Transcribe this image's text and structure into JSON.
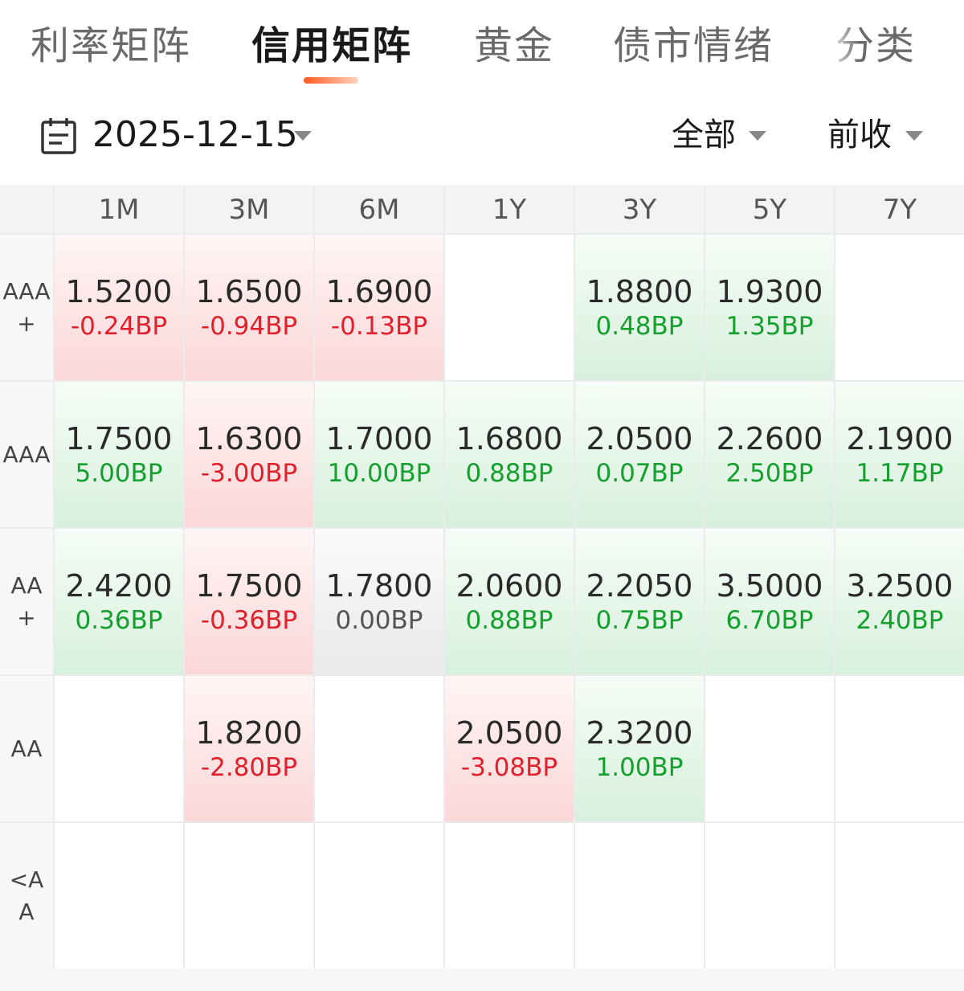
{
  "tabs": [
    "利率矩阵",
    "信用矩阵",
    "黄金",
    "债市情绪",
    "分类"
  ],
  "active_tab": 1,
  "filters": {
    "date": "2025-12-15",
    "scope": "全部",
    "price_basis": "前收"
  },
  "colors": {
    "accent": "#ff5a1f",
    "up_text": "#e0202a",
    "down_text": "#14a02c",
    "up_bg": "#fbd7d8",
    "down_bg": "#d7f0dd"
  },
  "matrix": {
    "columns": [
      "1M",
      "3M",
      "6M",
      "1Y",
      "3Y",
      "5Y",
      "7Y"
    ],
    "rows": [
      {
        "label": "AAA+",
        "cells": [
          {
            "value": "1.5200",
            "change": "-0.24BP",
            "trend": "up"
          },
          {
            "value": "1.6500",
            "change": "-0.94BP",
            "trend": "up"
          },
          {
            "value": "1.6900",
            "change": "-0.13BP",
            "trend": "up"
          },
          null,
          {
            "value": "1.8800",
            "change": "0.48BP",
            "trend": "down"
          },
          {
            "value": "1.9300",
            "change": "1.35BP",
            "trend": "down"
          },
          null
        ]
      },
      {
        "label": "AAA",
        "cells": [
          {
            "value": "1.7500",
            "change": "5.00BP",
            "trend": "down"
          },
          {
            "value": "1.6300",
            "change": "-3.00BP",
            "trend": "up"
          },
          {
            "value": "1.7000",
            "change": "10.00BP",
            "trend": "down"
          },
          {
            "value": "1.6800",
            "change": "0.88BP",
            "trend": "down"
          },
          {
            "value": "2.0500",
            "change": "0.07BP",
            "trend": "down"
          },
          {
            "value": "2.2600",
            "change": "2.50BP",
            "trend": "down"
          },
          {
            "value": "2.1900",
            "change": "1.17BP",
            "trend": "down"
          }
        ]
      },
      {
        "label": "AA+",
        "cells": [
          {
            "value": "2.4200",
            "change": "0.36BP",
            "trend": "down"
          },
          {
            "value": "1.7500",
            "change": "-0.36BP",
            "trend": "up"
          },
          {
            "value": "1.7800",
            "change": "0.00BP",
            "trend": "flat"
          },
          {
            "value": "2.0600",
            "change": "0.88BP",
            "trend": "down"
          },
          {
            "value": "2.2050",
            "change": "0.75BP",
            "trend": "down"
          },
          {
            "value": "3.5000",
            "change": "6.70BP",
            "trend": "down"
          },
          {
            "value": "3.2500",
            "change": "2.40BP",
            "trend": "down"
          }
        ]
      },
      {
        "label": "AA",
        "cells": [
          null,
          {
            "value": "1.8200",
            "change": "-2.80BP",
            "trend": "up"
          },
          null,
          {
            "value": "2.0500",
            "change": "-3.08BP",
            "trend": "up"
          },
          {
            "value": "2.3200",
            "change": "1.00BP",
            "trend": "down"
          },
          null,
          null
        ]
      },
      {
        "label": "<AA",
        "cells": [
          null,
          null,
          null,
          null,
          null,
          null,
          null
        ]
      }
    ]
  }
}
